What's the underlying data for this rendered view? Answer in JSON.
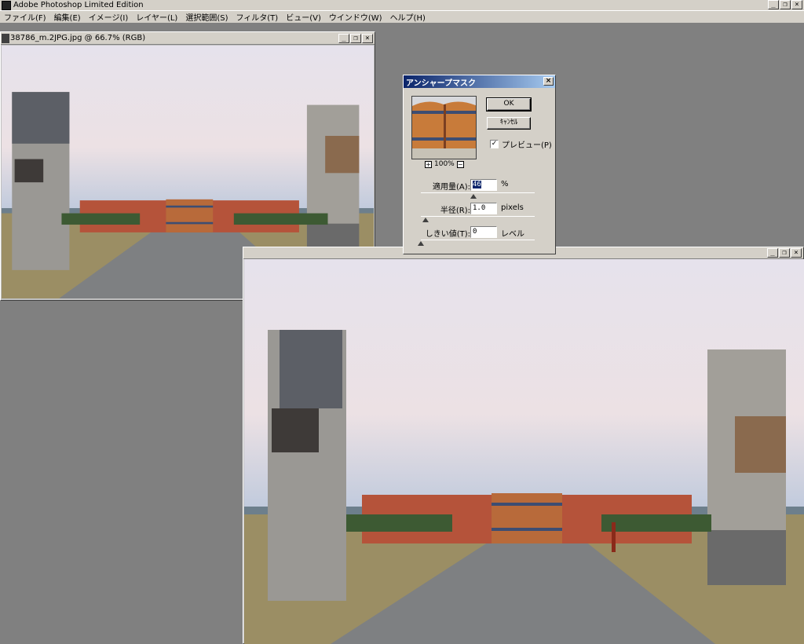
{
  "app": {
    "title": "Adobe Photoshop Limited Edition"
  },
  "menu": [
    "ファイル(F)",
    "編集(E)",
    "イメージ(I)",
    "レイヤー(L)",
    "選択範囲(S)",
    "フィルタ(T)",
    "ビュー(V)",
    "ウインドウ(W)",
    "ヘルプ(H)"
  ],
  "window_buttons": {
    "minimize": "_",
    "restore": "❐",
    "close": "×"
  },
  "doc1": {
    "title": "38786_m.2JPG.jpg @ 66.7% (RGB)"
  },
  "dialog": {
    "title": "アンシャープマスク",
    "ok_label": "OK",
    "cancel_label": "ｷｬﾝｾﾙ",
    "preview_label": "プレビュー(P)",
    "preview_checked": true,
    "zoom": "100%",
    "amount": {
      "label": "適用量(A):",
      "value": "46",
      "unit": "%",
      "level": 0.46
    },
    "radius": {
      "label": "半径(R):",
      "value": "1.0",
      "unit": "pixels",
      "level": 0.04
    },
    "threshold": {
      "label": "しきい値(T):",
      "value": "0",
      "unit": "レベル",
      "level": 0.0
    }
  },
  "colors": {
    "desktop": "#808080",
    "chrome": "#d4d0c8",
    "title_active": "#0a246a"
  }
}
